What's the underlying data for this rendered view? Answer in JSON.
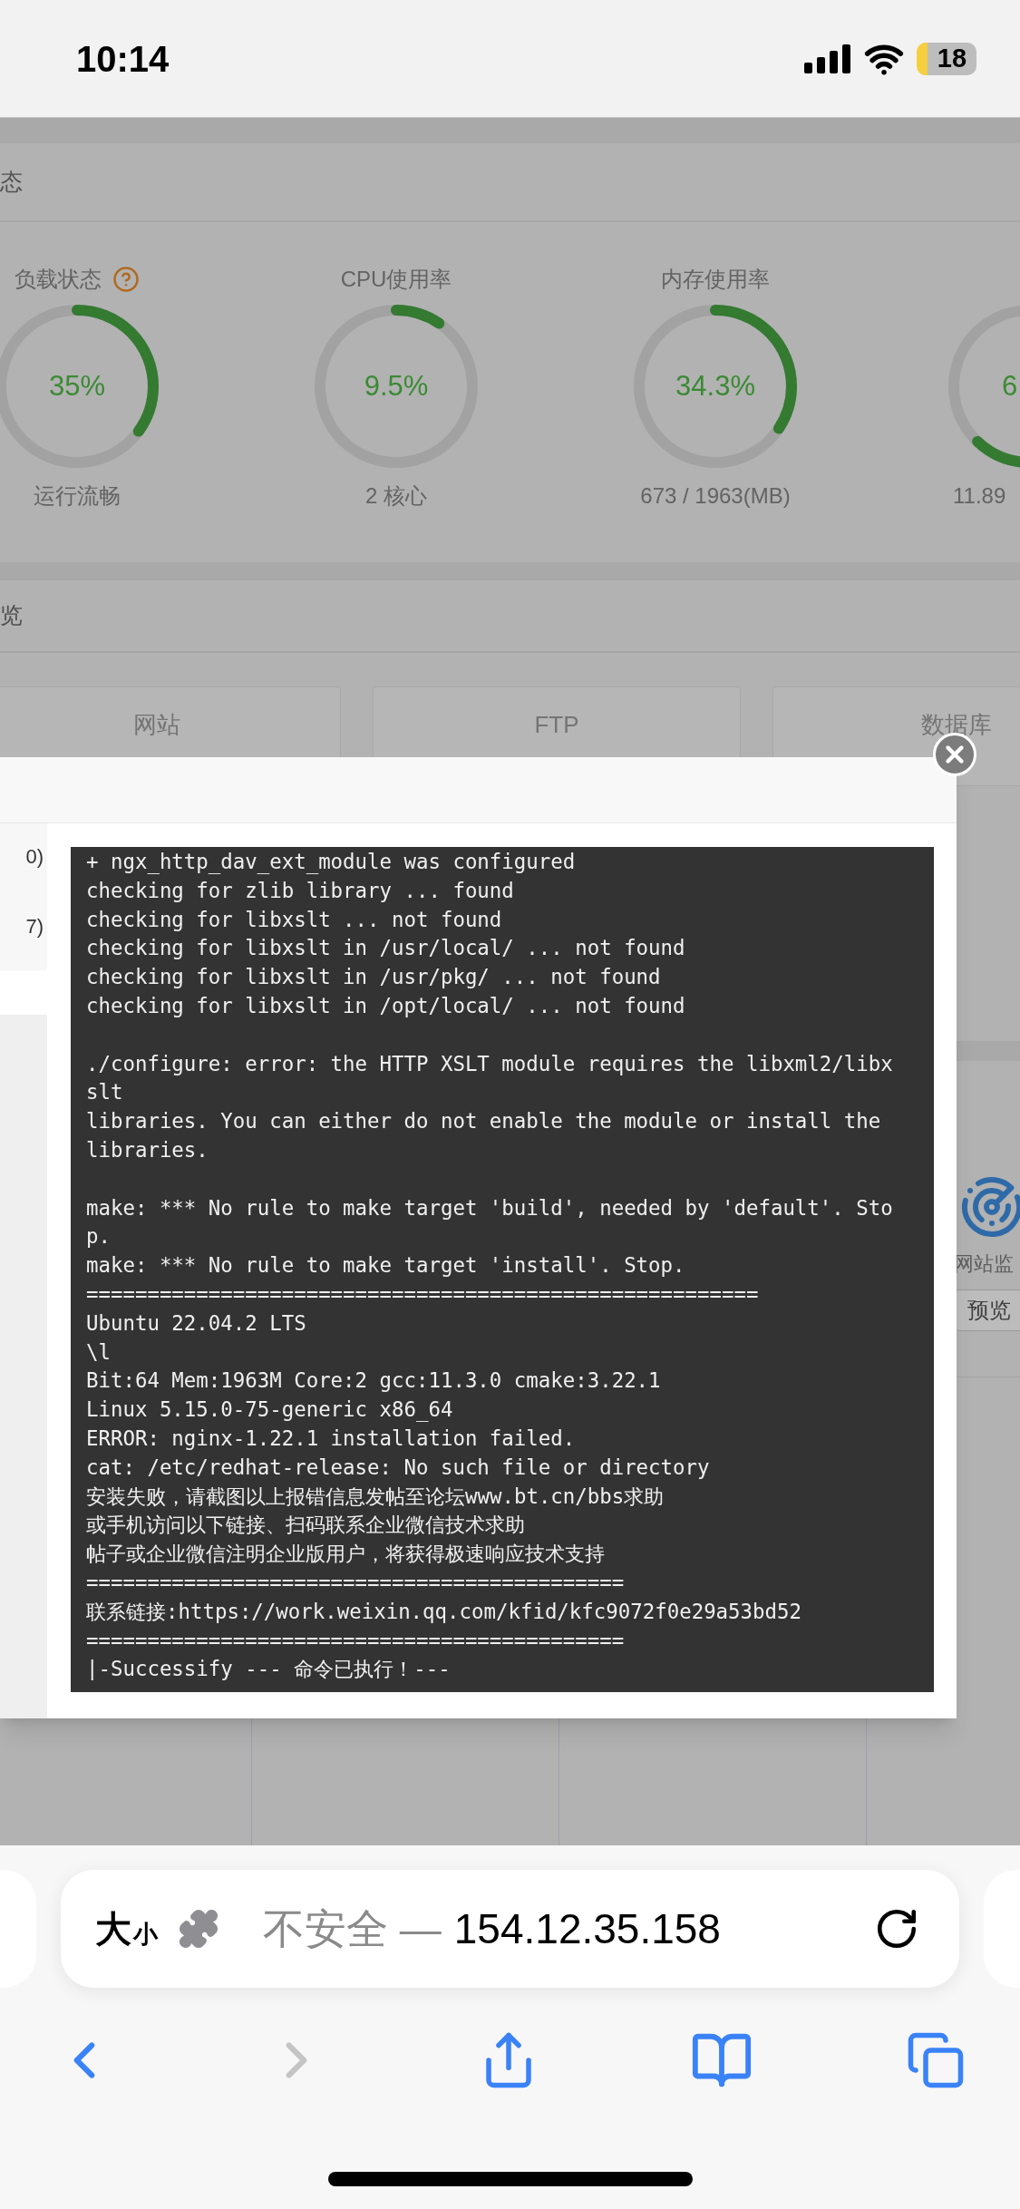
{
  "status_bar": {
    "time": "10:14",
    "battery": "18"
  },
  "status_panel": {
    "title": "态",
    "gauges": [
      {
        "title": "负载状态",
        "help": true,
        "value": "35%",
        "caption": "运行流畅"
      },
      {
        "title": "CPU使用率",
        "value": "9.5%",
        "caption": "2 核心"
      },
      {
        "title": "内存使用率",
        "value": "34.3%",
        "caption": "673 / 1963(MB)"
      },
      {
        "value": "6",
        "caption": "11.89"
      }
    ]
  },
  "overview": {
    "title": "览",
    "tiles": [
      {
        "label": "网站"
      },
      {
        "label": "FTP"
      },
      {
        "label": "数据库"
      }
    ]
  },
  "side_panel": {
    "label": "网站监",
    "button": "预览"
  },
  "dialog": {
    "sidebar": [
      "0)",
      "7)"
    ],
    "log": [
      [
        "+ ngx_http_dav_ext_module was configured",
        "checking for zlib library ... found",
        "checking for libxslt ... not found",
        "checking for libxslt in /usr/local/ ... not found",
        "checking for libxslt in /usr/pkg/ ... not found",
        "checking for libxslt in /opt/local/ ... not found"
      ],
      [
        "./configure: error: the HTTP XSLT module requires the libxml2/libxslt",
        "libraries. You can either do not enable the module or install the libraries."
      ],
      [
        "make: *** No rule to make target 'build', needed by 'default'. Stop.",
        "make: *** No rule to make target 'install'. Stop.",
        "=======================================================",
        "Ubuntu 22.04.2 LTS",
        "\\l",
        "Bit:64 Mem:1963M Core:2 gcc:11.3.0 cmake:3.22.1",
        "Linux 5.15.0-75-generic x86_64",
        "ERROR: nginx-1.22.1 installation failed.",
        "cat: /etc/redhat-release: No such file or directory",
        "安装失败，请截图以上报错信息发帖至论坛www.bt.cn/bbs求助",
        "或手机访问以下链接、扫码联系企业微信技术求助",
        "帖子或企业微信注明企业版用户，将获得极速响应技术支持",
        "============================================",
        "联系链接:https://work.weixin.qq.com/kfid/kfc9072f0e29a53bd52",
        "============================================",
        "|-Successify --- 命令已执行！---"
      ]
    ]
  },
  "browser": {
    "text_size_large": "大",
    "text_size_small": "小",
    "security": "不安全 —",
    "address": "154.12.35.158",
    "back_disabled": false,
    "forward_disabled": true
  }
}
